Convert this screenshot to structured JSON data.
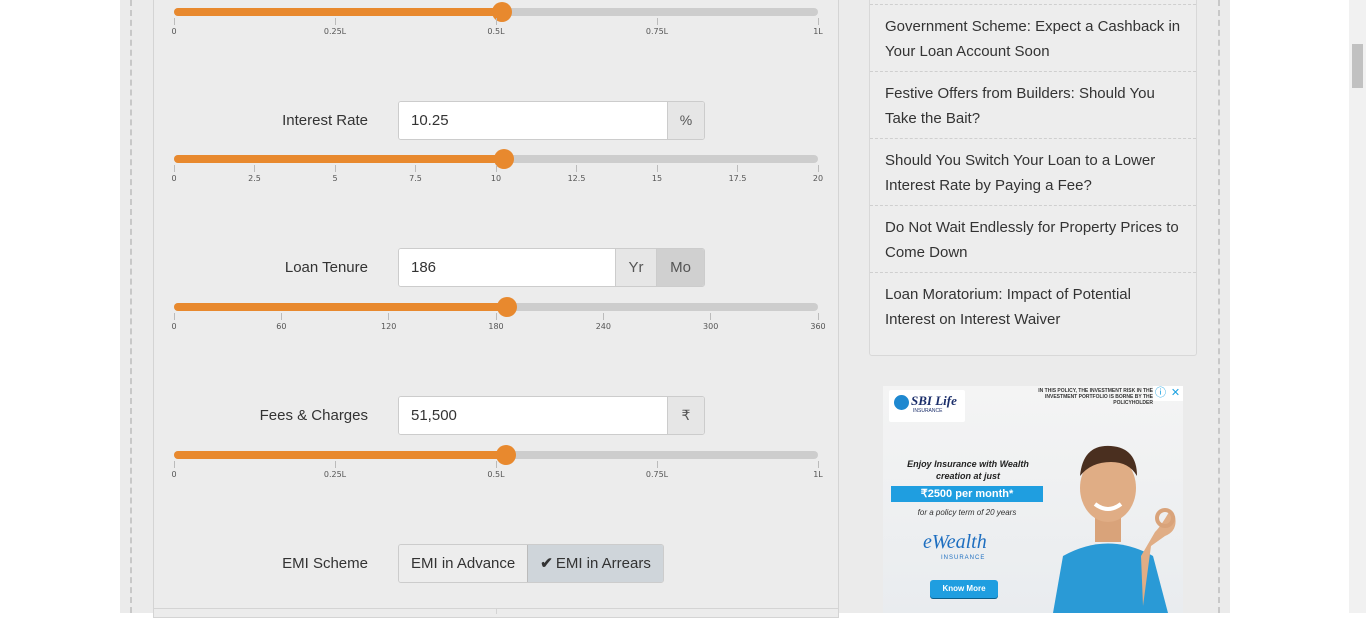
{
  "calculator": {
    "loan_amount_slider": {
      "value_fraction": 0.51,
      "ticks": [
        "0",
        "0.25L",
        "0.5L",
        "0.75L",
        "1L"
      ]
    },
    "interest_rate": {
      "label": "Interest Rate",
      "value": "10.25",
      "unit": "%",
      "slider_value_fraction": 0.5125,
      "ticks": [
        "0",
        "2.5",
        "5",
        "7.5",
        "10",
        "12.5",
        "15",
        "17.5",
        "20"
      ]
    },
    "loan_tenure": {
      "label": "Loan Tenure",
      "value": "186",
      "unit_year": "Yr",
      "unit_month": "Mo",
      "selected_unit": "Mo",
      "slider_value_fraction": 0.5167,
      "ticks": [
        "0",
        "60",
        "120",
        "180",
        "240",
        "300",
        "360"
      ]
    },
    "fees_charges": {
      "label": "Fees & Charges",
      "value": "51,500",
      "unit": "₹",
      "slider_value_fraction": 0.515,
      "ticks": [
        "0",
        "0.25L",
        "0.5L",
        "0.75L",
        "1L"
      ]
    },
    "emi_scheme": {
      "label": "EMI Scheme",
      "option_advance": "EMI in Advance",
      "option_arrears": "EMI in Arrears",
      "selected": "EMI in Arrears"
    }
  },
  "sidebar": {
    "articles": [
      "Government Scheme: Expect a Cashback in Your Loan Account Soon",
      "Festive Offers from Builders: Should You Take the Bait?",
      "Should You Switch Your Loan to a Lower Interest Rate by Paying a Fee?",
      "Do Not Wait Endlessly for Property Prices to Come Down",
      "Loan Moratorium: Impact of Potential Interest on Interest Waiver"
    ]
  },
  "ad": {
    "brand": "SBI Life",
    "brand_sub": "INSURANCE",
    "disclaimer": "IN THIS POLICY, THE INVESTMENT RISK IN THE INVESTMENT PORTFOLIO IS BORNE BY THE POLICYHOLDER",
    "headline": "Enjoy Insurance with Wealth creation at just",
    "price": "₹2500 per month*",
    "term": "for a policy term of 20 years",
    "product": "eWealth",
    "product_sub": "INSURANCE",
    "cta": "Know More"
  },
  "colors": {
    "accent_orange": "#e8892e",
    "slider_track": "#cdcdcd",
    "ad_blue": "#1f9ee0"
  }
}
